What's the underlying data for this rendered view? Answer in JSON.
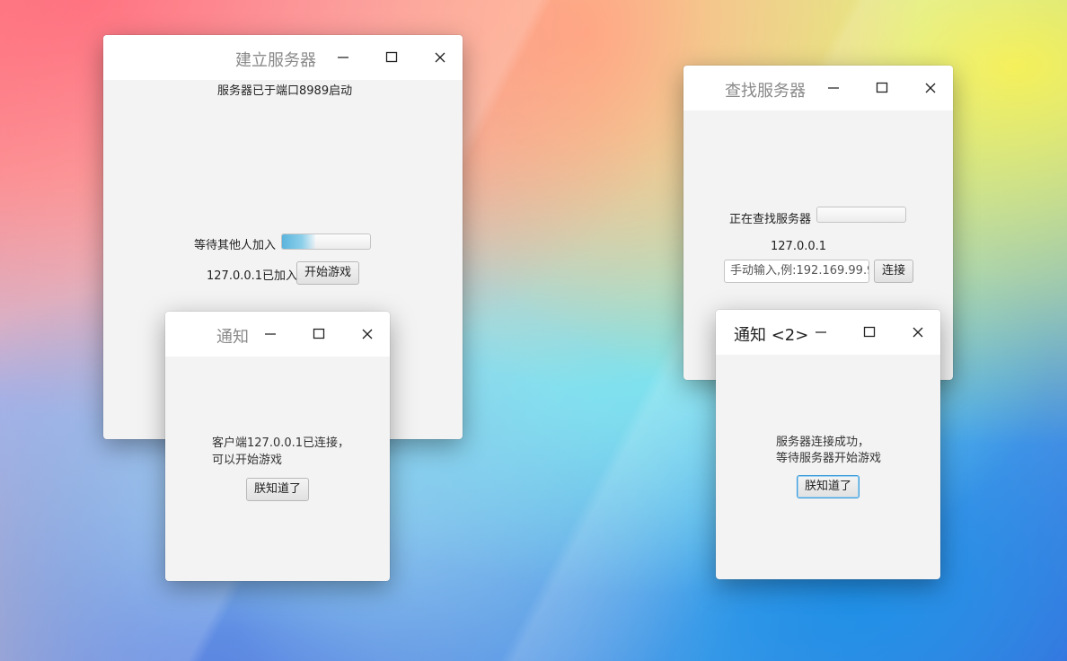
{
  "server_window": {
    "title": "建立服务器",
    "status": "服务器已于端口8989启动",
    "waiting_label": "等待其他人加入",
    "waiting_progress": 0.38,
    "joined_label": "127.0.0.1已加入",
    "start_button": "开始游戏"
  },
  "find_window": {
    "title": "查找服务器",
    "searching_label": "正在查找服务器",
    "found_ip": "127.0.0.1",
    "ip_input_placeholder": "手动输入,例:192.169.99.9",
    "connect_button": "连接"
  },
  "notice1": {
    "title": "通知",
    "message_line1": "客户端127.0.0.1已连接，",
    "message_line2": "可以开始游戏",
    "ok_button": "朕知道了"
  },
  "notice2": {
    "title": "通知 <2>",
    "message_line1": "服务器连接成功，",
    "message_line2": "等待服务器开始游戏",
    "ok_button": "朕知道了"
  },
  "icons": {
    "minimize": "minimize-icon",
    "maximize": "maximize-icon",
    "close": "close-icon"
  }
}
